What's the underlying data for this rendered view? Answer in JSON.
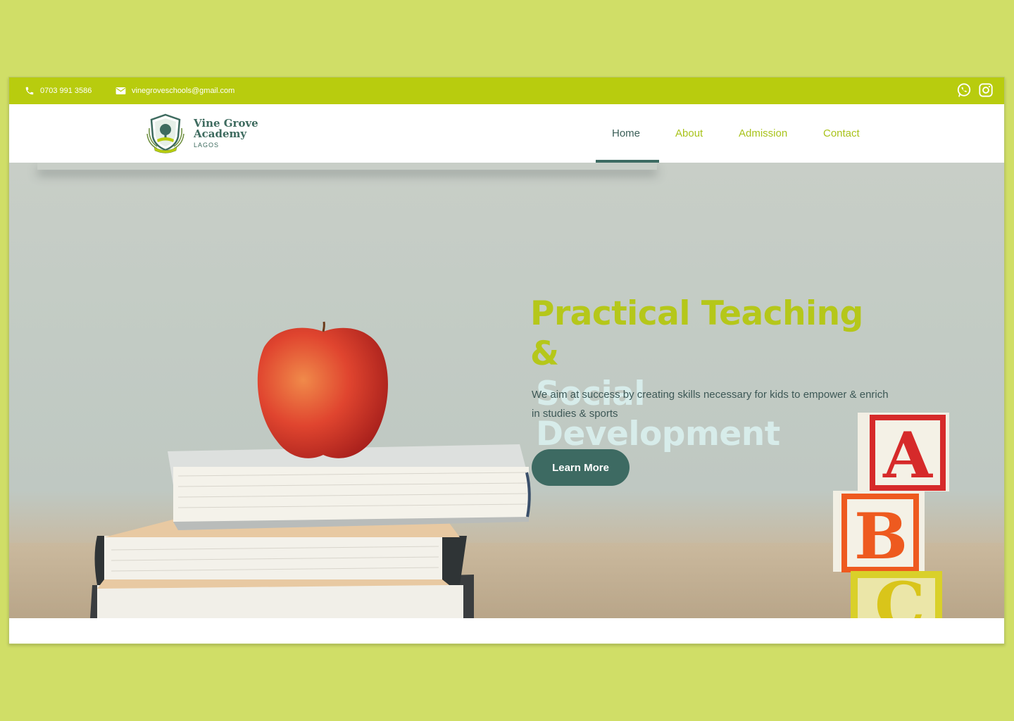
{
  "topbar": {
    "phone": "0703 991 3586",
    "email": "vinegroveschools@gmail.com",
    "social": [
      "whatsapp-icon",
      "instagram-icon"
    ]
  },
  "brand": {
    "name_line1": "Vine Grove",
    "name_line2": "Academy",
    "location": "LAGOS"
  },
  "nav": {
    "items": [
      {
        "label": "Home",
        "active": true
      },
      {
        "label": "About",
        "active": false
      },
      {
        "label": "Admission",
        "active": false
      },
      {
        "label": "Contact",
        "active": false
      }
    ]
  },
  "hero": {
    "title_line1": "Practical Teaching &",
    "title_line2": "Social Development",
    "subtitle": "We aim at success by creating skills necessary for kids to empower & enrich in studies & sports",
    "cta_label": "Learn More",
    "blocks": [
      "A",
      "B",
      "C"
    ]
  },
  "colors": {
    "page_bg": "#d0de67",
    "accent": "#b8cc0e",
    "primary": "#3d6a62",
    "title_light": "#d7ecea"
  }
}
